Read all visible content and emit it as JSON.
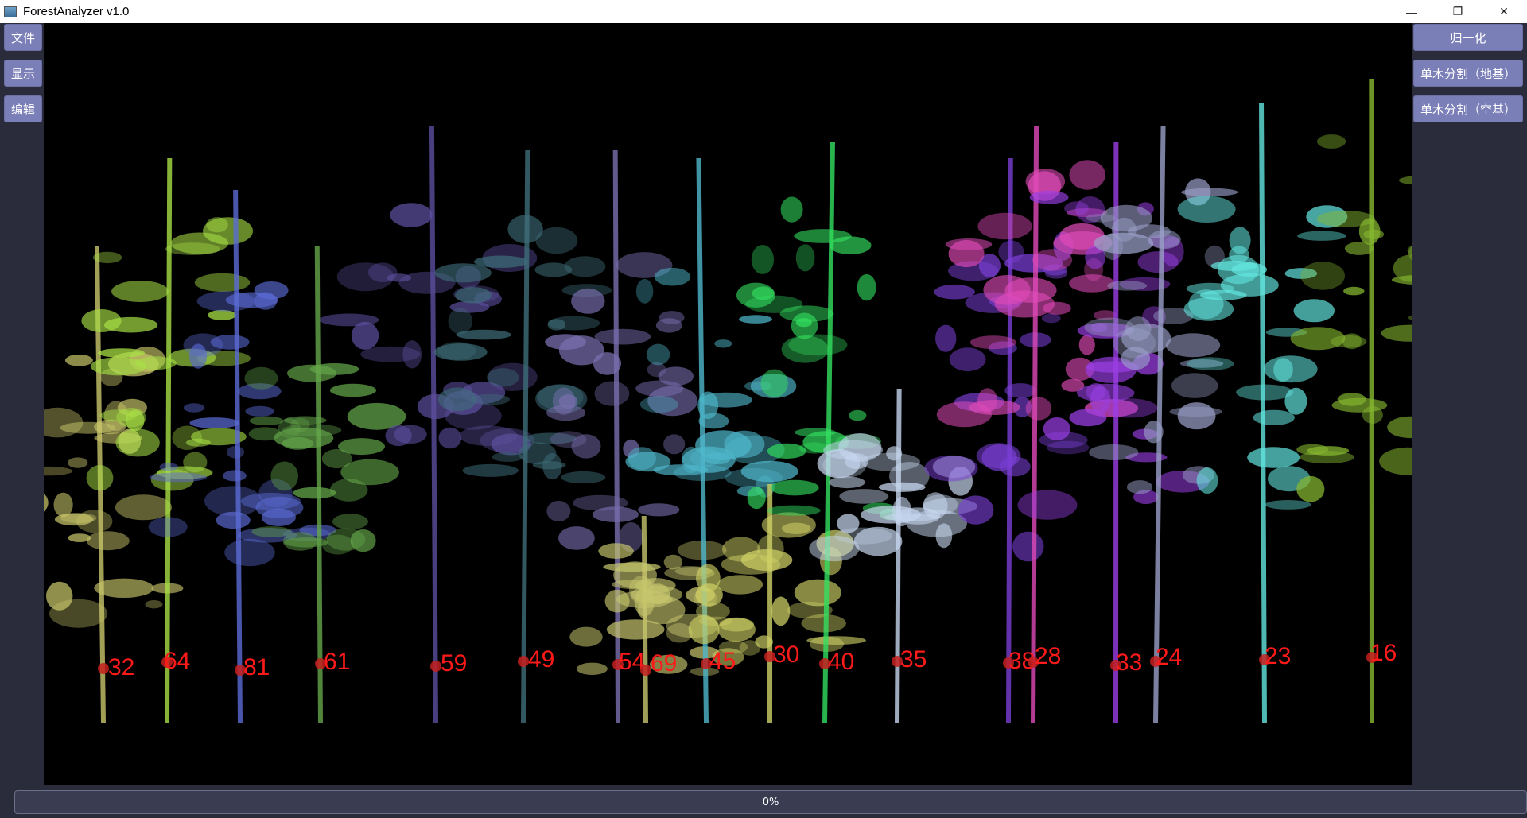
{
  "window": {
    "title": "ForestAnalyzer v1.0",
    "min": "—",
    "max": "❐",
    "close": "✕"
  },
  "left_menu": {
    "file": "文件",
    "display": "显示",
    "edit": "编辑"
  },
  "right_menu": {
    "normalize": "归一化",
    "seg_ground": "单木分割（地基）",
    "seg_air": "单木分割（空基）"
  },
  "progress": {
    "text": "0%",
    "value": 0
  },
  "trees": [
    {
      "id": "32",
      "color": "#c9c66a"
    },
    {
      "id": "64",
      "color": "#a8e045"
    },
    {
      "id": "81",
      "color": "#5b6bd6"
    },
    {
      "id": "61",
      "color": "#64a64a"
    },
    {
      "id": "59",
      "color": "#5c4f9e"
    },
    {
      "id": "49",
      "color": "#3f6e7a"
    },
    {
      "id": "54",
      "color": "#7a6fb0"
    },
    {
      "id": "69",
      "color": "#c7c66e"
    },
    {
      "id": "45",
      "color": "#4fb8cc"
    },
    {
      "id": "30",
      "color": "#cfd166"
    },
    {
      "id": "40",
      "color": "#33e060"
    },
    {
      "id": "35",
      "color": "#c6d6ee"
    },
    {
      "id": "38",
      "color": "#7a3fd6"
    },
    {
      "id": "28",
      "color": "#e04ab8"
    },
    {
      "id": "33",
      "color": "#9b3fe6"
    },
    {
      "id": "24",
      "color": "#9aa0c8"
    },
    {
      "id": "23",
      "color": "#63e6e0"
    },
    {
      "id": "16",
      "color": "#86b830"
    }
  ]
}
